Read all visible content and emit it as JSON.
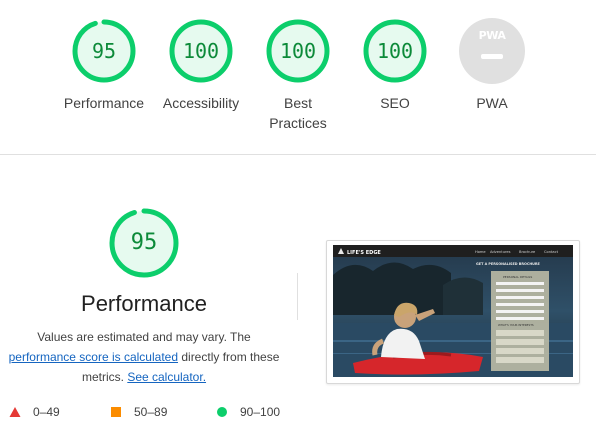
{
  "categories": [
    {
      "label": "Performance",
      "score": "95",
      "value": 95
    },
    {
      "label": "Accessibility",
      "score": "100",
      "value": 100
    },
    {
      "label": "Best Practices",
      "label_line1": "Best",
      "label_line2": "Practices",
      "score": "100",
      "value": 100
    },
    {
      "label": "SEO",
      "score": "100",
      "value": 100
    },
    {
      "label": "PWA",
      "badge_text": "PWA"
    }
  ],
  "performance": {
    "score": "95",
    "value": 95,
    "title": "Performance",
    "desc_part1": "Values are estimated and may vary. The ",
    "desc_link1": "performance score is calculated",
    "desc_part2": " directly from these metrics. ",
    "desc_link2": "See calculator."
  },
  "screenshot": {
    "logo": "LIFE'S EDGE",
    "nav": [
      "Home",
      "Adventures",
      "Brochure",
      "Contact"
    ],
    "form_title": "GET A PERSONALISED BROCHURE",
    "form_heading": "PERSONAL DETAILS",
    "form_section": "WHAT'S YOUR INTERESTS"
  },
  "legend": [
    {
      "range": "0–49",
      "shape": "triangle",
      "color": "#e53935"
    },
    {
      "range": "50–89",
      "shape": "square",
      "color": "#fb8c00"
    },
    {
      "range": "90–100",
      "shape": "circle",
      "color": "#0cce6b"
    }
  ],
  "colors": {
    "pass": "#0cce6b",
    "pass_text": "#0c8a39",
    "pass_fill": "#e6faef",
    "pwa_gray": "#e0e0e0"
  }
}
